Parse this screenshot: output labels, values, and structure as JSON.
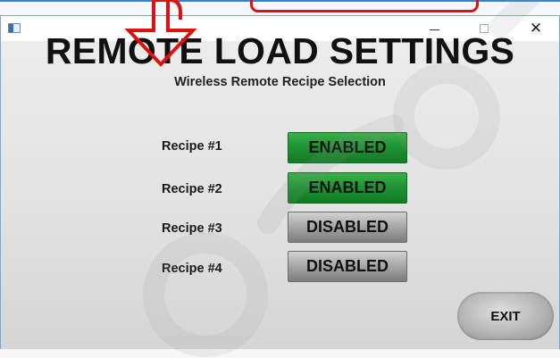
{
  "window": {
    "title": "REMOTE LOAD SETTINGS",
    "subtitle": "Wireless Remote Recipe Selection",
    "close_glyph": "✕"
  },
  "recipes": [
    {
      "label": "Recipe #1",
      "status": "ENABLED"
    },
    {
      "label": "Recipe #2",
      "status": "ENABLED"
    },
    {
      "label": "Recipe #3",
      "status": "DISABLED"
    },
    {
      "label": "Recipe #4",
      "status": "DISABLED"
    }
  ],
  "exit_label": "EXIT",
  "colors": {
    "enabled": "#1f9433",
    "disabled": "#a9a9a9",
    "annotation": "#e01010"
  },
  "icons": {
    "app": "app-window-icon",
    "minimize": "minimize-icon",
    "maximize": "maximize-icon",
    "close": "close-icon",
    "annotation_arrow": "red-down-arrow-icon"
  }
}
